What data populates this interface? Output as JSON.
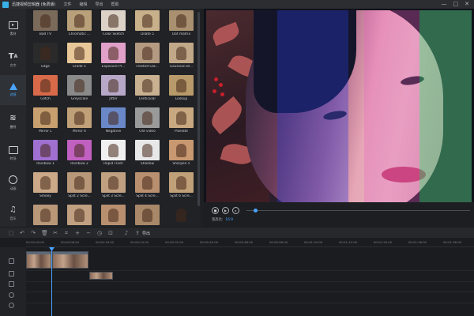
{
  "window": {
    "title": "迅捷视频剪辑器 (免费版)",
    "menu": [
      "文件",
      "编辑",
      "导出",
      "帮助"
    ],
    "controls": [
      "—",
      "□",
      "✕"
    ]
  },
  "rail": {
    "items": [
      {
        "label": "素材",
        "icon": "folder-play-icon"
      },
      {
        "label": "文字",
        "icon": "text-icon"
      },
      {
        "label": "滤镜",
        "icon": "filter-icon",
        "active": true
      },
      {
        "label": "叠附",
        "icon": "layers-icon"
      },
      {
        "label": "转场",
        "icon": "transition-icon"
      },
      {
        "label": "动画",
        "icon": "animation-icon"
      },
      {
        "label": "音乐",
        "icon": "music-icon"
      }
    ]
  },
  "effects": [
    {
      "label": "Bad TV",
      "color": "#7a6a5a"
    },
    {
      "label": "Chromatic ...",
      "color": "#b8a07a"
    },
    {
      "label": "Color Sketch",
      "color": "#dcd2c8"
    },
    {
      "label": "Dilate 5",
      "color": "#c8b08a"
    },
    {
      "label": "Dot matrix",
      "color": "#a89070"
    },
    {
      "label": "Edge",
      "color": "#2a2a2a"
    },
    {
      "label": "Erode 5",
      "color": "#e8c898"
    },
    {
      "label": "Exposure Pl...",
      "color": "#e0a0c8"
    },
    {
      "label": "Frosted Gla...",
      "color": "#b49a80"
    },
    {
      "label": "Gaussian Bl...",
      "color": "#c0a888"
    },
    {
      "label": "Glitch",
      "color": "#d86a4a"
    },
    {
      "label": "Greyscale",
      "color": "#8a8a8a"
    },
    {
      "label": "Jitter",
      "color": "#b8a8c8"
    },
    {
      "label": "Lenticular",
      "color": "#c8b090"
    },
    {
      "label": "Lookup",
      "color": "#b89a6a"
    },
    {
      "label": "Mirror L",
      "color": "#c8a070"
    },
    {
      "label": "Mirror R",
      "color": "#c0a078"
    },
    {
      "label": "Negative",
      "color": "#6a88c8"
    },
    {
      "label": "Old video",
      "color": "#9a9a9a"
    },
    {
      "label": "Pixelate",
      "color": "#c8a880"
    },
    {
      "label": "Rainbow 1",
      "color": "#a070d0"
    },
    {
      "label": "Rainbow 2",
      "color": "#c060c0"
    },
    {
      "label": "Rapid Flash",
      "color": "#f0f0f0"
    },
    {
      "label": "Shadow",
      "color": "#e8e8e8"
    },
    {
      "label": "Sharpen 5",
      "color": "#c89870"
    },
    {
      "label": "Smoey",
      "color": "#caa888"
    },
    {
      "label": "Split 2 Scre...",
      "color": "#b89878"
    },
    {
      "label": "Split 3 Scre...",
      "color": "#c0a080"
    },
    {
      "label": "Split 4 Scre...",
      "color": "#b89070"
    },
    {
      "label": "Split 6 Scre...",
      "color": "#c0a078"
    },
    {
      "label": "",
      "color": "#b89878"
    },
    {
      "label": "",
      "color": "#c0a080"
    },
    {
      "label": "",
      "color": "#b89070"
    },
    {
      "label": "",
      "color": "#a88868"
    },
    {
      "label": "",
      "color": "#202226"
    }
  ],
  "player": {
    "ratio_label": "宽高比:",
    "ratio_value": "16:9",
    "progress": 0.04
  },
  "toolbar": {
    "export_label": "导出"
  },
  "timeline": {
    "ticks": [
      "00:00:00.00",
      "00:00:08.00",
      "00:00:16.00",
      "00:00:24.00",
      "00:00:32.00",
      "00:00:40.00",
      "00:00:48.00",
      "00:00:56.00",
      "00:01:04.00",
      "00:01:12.00",
      "00:01:20.00",
      "00:01:28.00",
      "00:01:36.00"
    ]
  },
  "accent": "#4aa3ff"
}
